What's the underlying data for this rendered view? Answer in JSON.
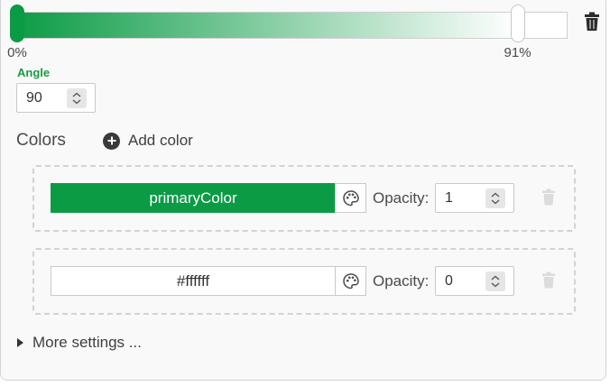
{
  "gradient": {
    "stops": [
      {
        "label": "0%",
        "position": 0,
        "color": "#0b9b45"
      },
      {
        "label": "91%",
        "position": 91,
        "color": "#ffffff"
      }
    ]
  },
  "angle": {
    "label": "Angle",
    "value": "90"
  },
  "colors": {
    "title": "Colors",
    "add_label": "Add color",
    "items": [
      {
        "name": "primaryColor",
        "swatch_color": "#0b9b45",
        "text_color": "#ffffff",
        "opacity_label": "Opacity:",
        "opacity": "1"
      },
      {
        "name": "#ffffff",
        "swatch_color": "#ffffff",
        "text_color": "#333333",
        "opacity_label": "Opacity:",
        "opacity": "0"
      }
    ]
  },
  "more_settings": {
    "label": "More settings ..."
  },
  "icons": {
    "delete": "trash-icon",
    "palette": "palette-icon",
    "add": "plus-circle-icon",
    "spinner": "spinner-icon",
    "expand": "caret-right-icon"
  },
  "theme": {
    "accent": "#0b9b45",
    "accent_text": "#1a9a45"
  }
}
